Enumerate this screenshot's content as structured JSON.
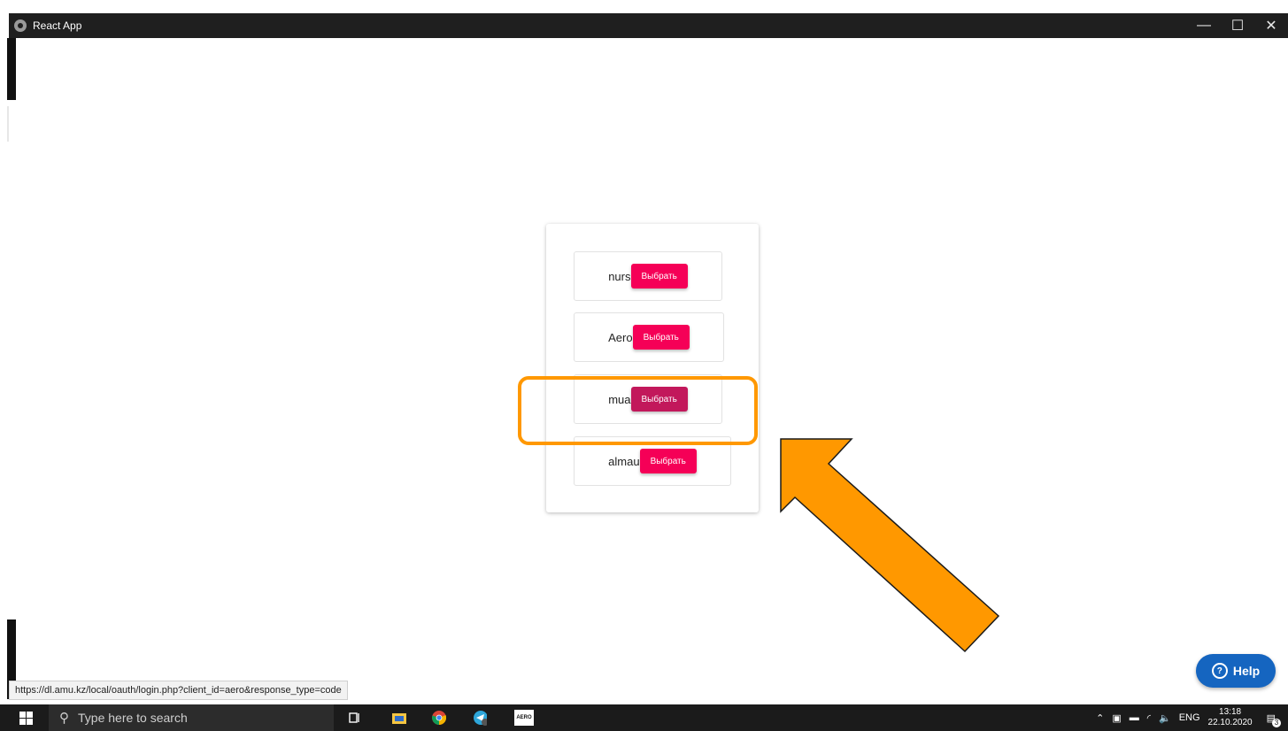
{
  "window": {
    "title": "React App",
    "minimize_glyph": "—",
    "maximize_glyph": "☐",
    "close_glyph": "✕"
  },
  "organizations": [
    {
      "name": "nurs",
      "button_label": "Выбрать"
    },
    {
      "name": "Aero",
      "button_label": "Выбрать"
    },
    {
      "name": "mua",
      "button_label": "Выбрать"
    },
    {
      "name": "almau",
      "button_label": "Выбрать"
    }
  ],
  "colors": {
    "button_bg": "#f50057",
    "button_hover_bg": "#c2185b",
    "highlight": "#ff9800",
    "help_bg": "#1565c0"
  },
  "help_button": {
    "label": "Help",
    "icon_glyph": "?"
  },
  "status_bar": {
    "url": "https://dl.amu.kz/local/oauth/login.php?client_id=aero&response_type=code"
  },
  "taskbar": {
    "search_placeholder": "Type here to search",
    "app_labels": {
      "aero": "AERO"
    },
    "tray_language": "ENG",
    "clock_time": "13:18",
    "clock_date": "22.10.2020",
    "notification_count": "3"
  }
}
